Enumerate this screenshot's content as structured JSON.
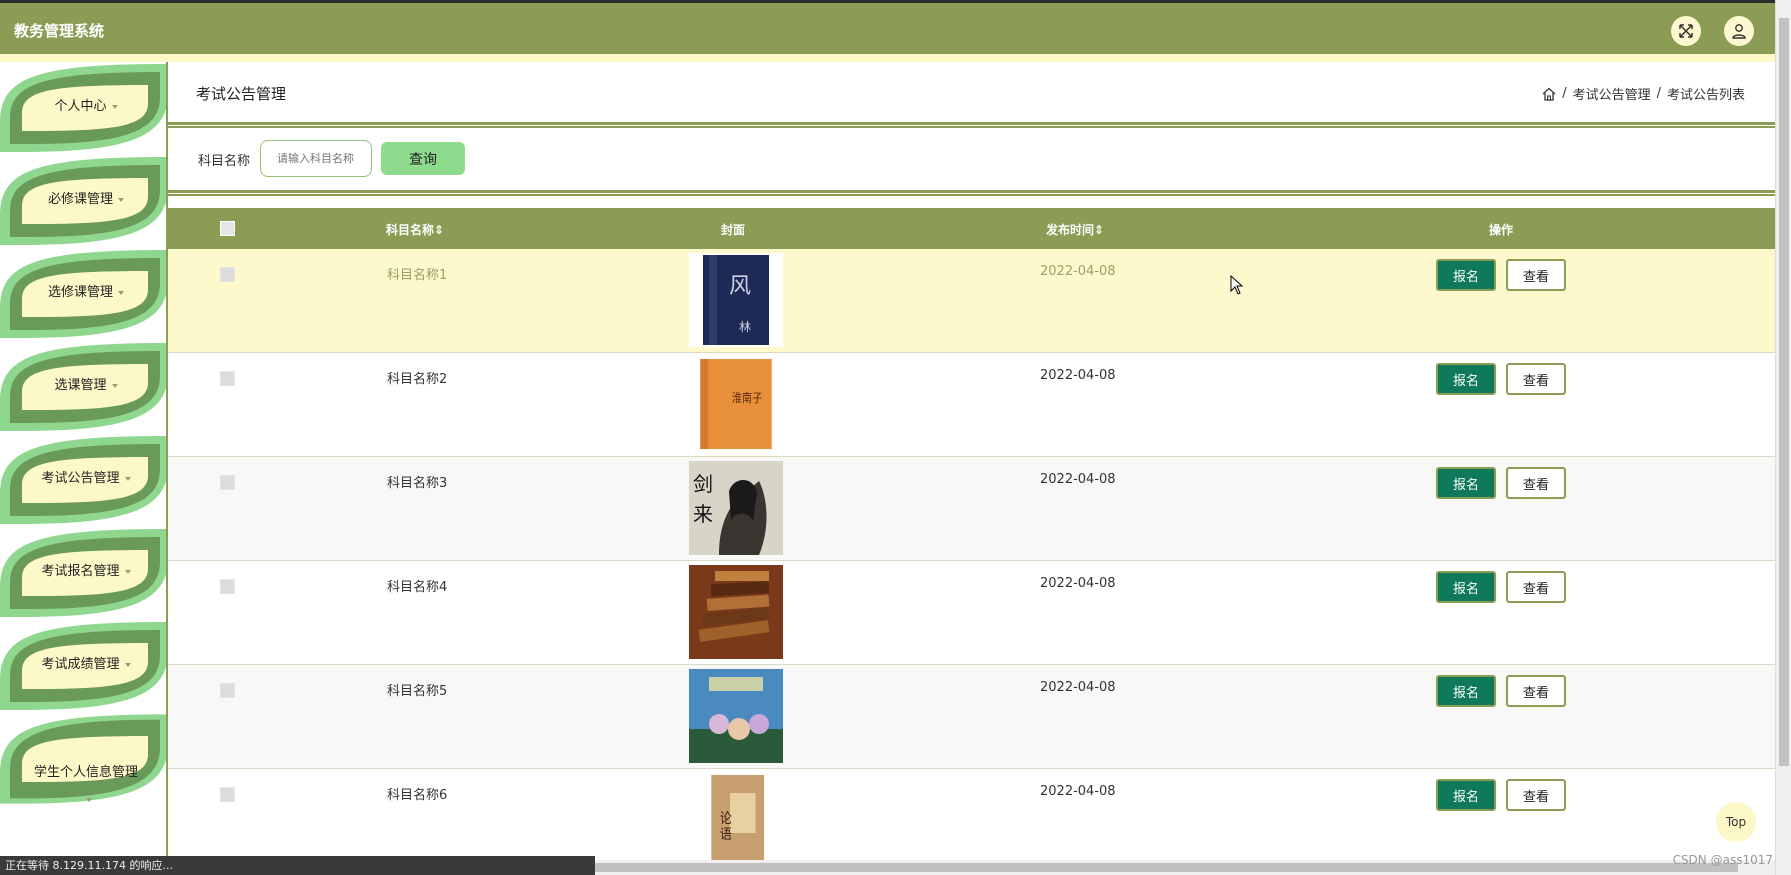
{
  "app": {
    "title": "教务管理系统"
  },
  "sidebar": {
    "items": [
      {
        "label": "个人中心"
      },
      {
        "label": "必修课管理"
      },
      {
        "label": "选修课管理"
      },
      {
        "label": "选课管理"
      },
      {
        "label": "考试公告管理"
      },
      {
        "label": "考试报名管理"
      },
      {
        "label": "考试成绩管理"
      },
      {
        "label": "学生个人信息管理"
      }
    ]
  },
  "page": {
    "title": "考试公告管理",
    "breadcrumb": [
      "考试公告管理",
      "考试公告列表"
    ],
    "breadcrumb_sep": "/"
  },
  "search": {
    "label": "科目名称",
    "placeholder": "请输入科目名称",
    "button": "查询"
  },
  "table": {
    "headers": {
      "name": "科目名称",
      "cover": "封面",
      "date": "发布时间",
      "actions": "操作"
    },
    "sort_indicator": "⇕",
    "rows": [
      {
        "name": "科目名称1",
        "date": "2022-04-08",
        "cover": "cover-1",
        "highlighted": true
      },
      {
        "name": "科目名称2",
        "date": "2022-04-08",
        "cover": "cover-2"
      },
      {
        "name": "科目名称3",
        "date": "2022-04-08",
        "cover": "cover-3"
      },
      {
        "name": "科目名称4",
        "date": "2022-04-08",
        "cover": "cover-4"
      },
      {
        "name": "科目名称5",
        "date": "2022-04-08",
        "cover": "cover-5"
      },
      {
        "name": "科目名称6",
        "date": "2022-04-08",
        "cover": "cover-6"
      }
    ],
    "apply_label": "报名",
    "view_label": "查看"
  },
  "status_bar": {
    "text": "正在等待 8.129.11.174 的响应..."
  },
  "watermark": {
    "text": "CSDN @ass1017"
  },
  "top_button": {
    "label": "Top"
  },
  "colors": {
    "accent": "#8b9d55",
    "highlight_row": "#fdf9cc",
    "apply_button": "#0f7a5a",
    "search_button": "#8edb8e"
  }
}
